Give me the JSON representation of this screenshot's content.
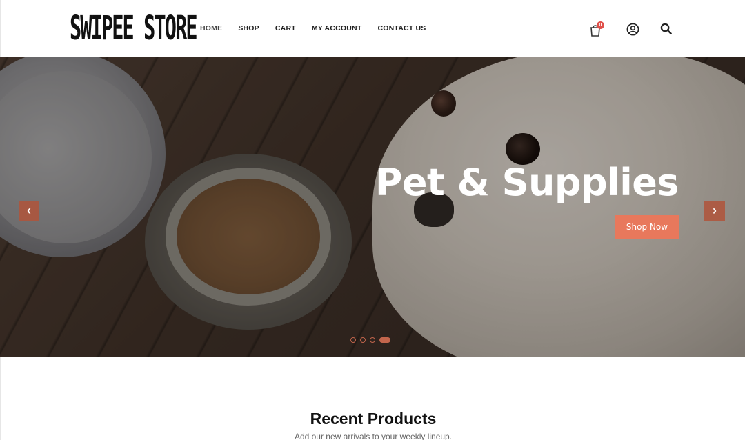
{
  "header": {
    "logo": "SWIPEE STORE",
    "nav": [
      {
        "label": "HOME"
      },
      {
        "label": "SHOP"
      },
      {
        "label": "CART"
      },
      {
        "label": "MY ACCOUNT"
      },
      {
        "label": "CONTACT US"
      }
    ],
    "cart_count": "0",
    "icons": [
      "cart-icon",
      "user-icon",
      "search-icon"
    ]
  },
  "hero": {
    "title": "Pet & Supplies",
    "cta": "Shop Now",
    "prev_arrow": "‹",
    "next_arrow": "›",
    "slides_total": 4,
    "active_slide": 4
  },
  "recent": {
    "title": "Recent Products",
    "subtitle": "Add our new arrivals to your weekly lineup."
  },
  "colors": {
    "accent": "#e8785c",
    "badge": "#e0504a"
  }
}
